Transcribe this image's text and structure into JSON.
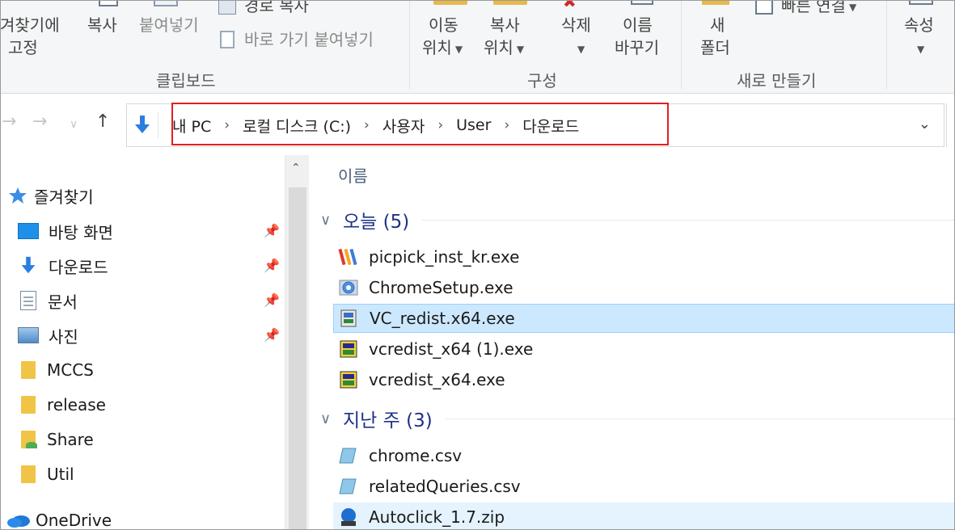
{
  "ribbon": {
    "pin_quick_access": {
      "line1": "겨찾기에",
      "line2": "고정"
    },
    "copy": "복사",
    "paste": "붙여넣기",
    "copy_path": "경로 복사",
    "paste_shortcut": "바로 가기 붙여넣기",
    "clipboard_group": "클립보드",
    "move_to": {
      "line1": "이동",
      "line2": "위치"
    },
    "copy_to": {
      "line1": "복사",
      "line2": "위치"
    },
    "delete": "삭제",
    "rename": {
      "line1": "이름",
      "line2": "바꾸기"
    },
    "organize_group": "구성",
    "new_folder": {
      "line1": "새",
      "line2": "폴더"
    },
    "easy_access": "빠른 연결",
    "new_group": "새로 만들기",
    "properties": "속성",
    "accent_color": "#e8b94a"
  },
  "address_bar": {
    "crumbs": [
      "내 PC",
      "로컬 디스크 (C:)",
      "사용자",
      "User",
      "다운로드"
    ],
    "highlight_color": "#e02020"
  },
  "nav_pane": {
    "quick_access": "즐겨찾기",
    "items": [
      {
        "label": "바탕 화면",
        "icon": "desktop-icon",
        "pinned": true
      },
      {
        "label": "다운로드",
        "icon": "download-icon",
        "pinned": true
      },
      {
        "label": "문서",
        "icon": "document-icon",
        "pinned": true
      },
      {
        "label": "사진",
        "icon": "pictures-icon",
        "pinned": true
      },
      {
        "label": "MCCS",
        "icon": "folder-icon",
        "pinned": false
      },
      {
        "label": "release",
        "icon": "folder-icon",
        "pinned": false
      },
      {
        "label": "Share",
        "icon": "shared-folder-icon",
        "pinned": false
      },
      {
        "label": "Util",
        "icon": "folder-icon",
        "pinned": false
      }
    ],
    "onedrive": "OneDrive"
  },
  "file_list": {
    "column_name": "이름",
    "groups": [
      {
        "label": "오늘 (5)",
        "files": [
          {
            "name": "picpick_inst_kr.exe",
            "icon": "picpick-icon",
            "state": "normal"
          },
          {
            "name": "ChromeSetup.exe",
            "icon": "chrome-setup-icon",
            "state": "normal"
          },
          {
            "name": "VC_redist.x64.exe",
            "icon": "installer-icon",
            "state": "selected"
          },
          {
            "name": "vcredist_x64 (1).exe",
            "icon": "installer-icon",
            "state": "normal"
          },
          {
            "name": "vcredist_x64.exe",
            "icon": "installer-icon",
            "state": "normal"
          }
        ]
      },
      {
        "label": "지난 주 (3)",
        "files": [
          {
            "name": "chrome.csv",
            "icon": "csv-icon",
            "state": "normal"
          },
          {
            "name": "relatedQueries.csv",
            "icon": "csv-icon",
            "state": "normal"
          },
          {
            "name": "Autoclick_1.7.zip",
            "icon": "zip-icon",
            "state": "hover"
          }
        ]
      }
    ]
  }
}
